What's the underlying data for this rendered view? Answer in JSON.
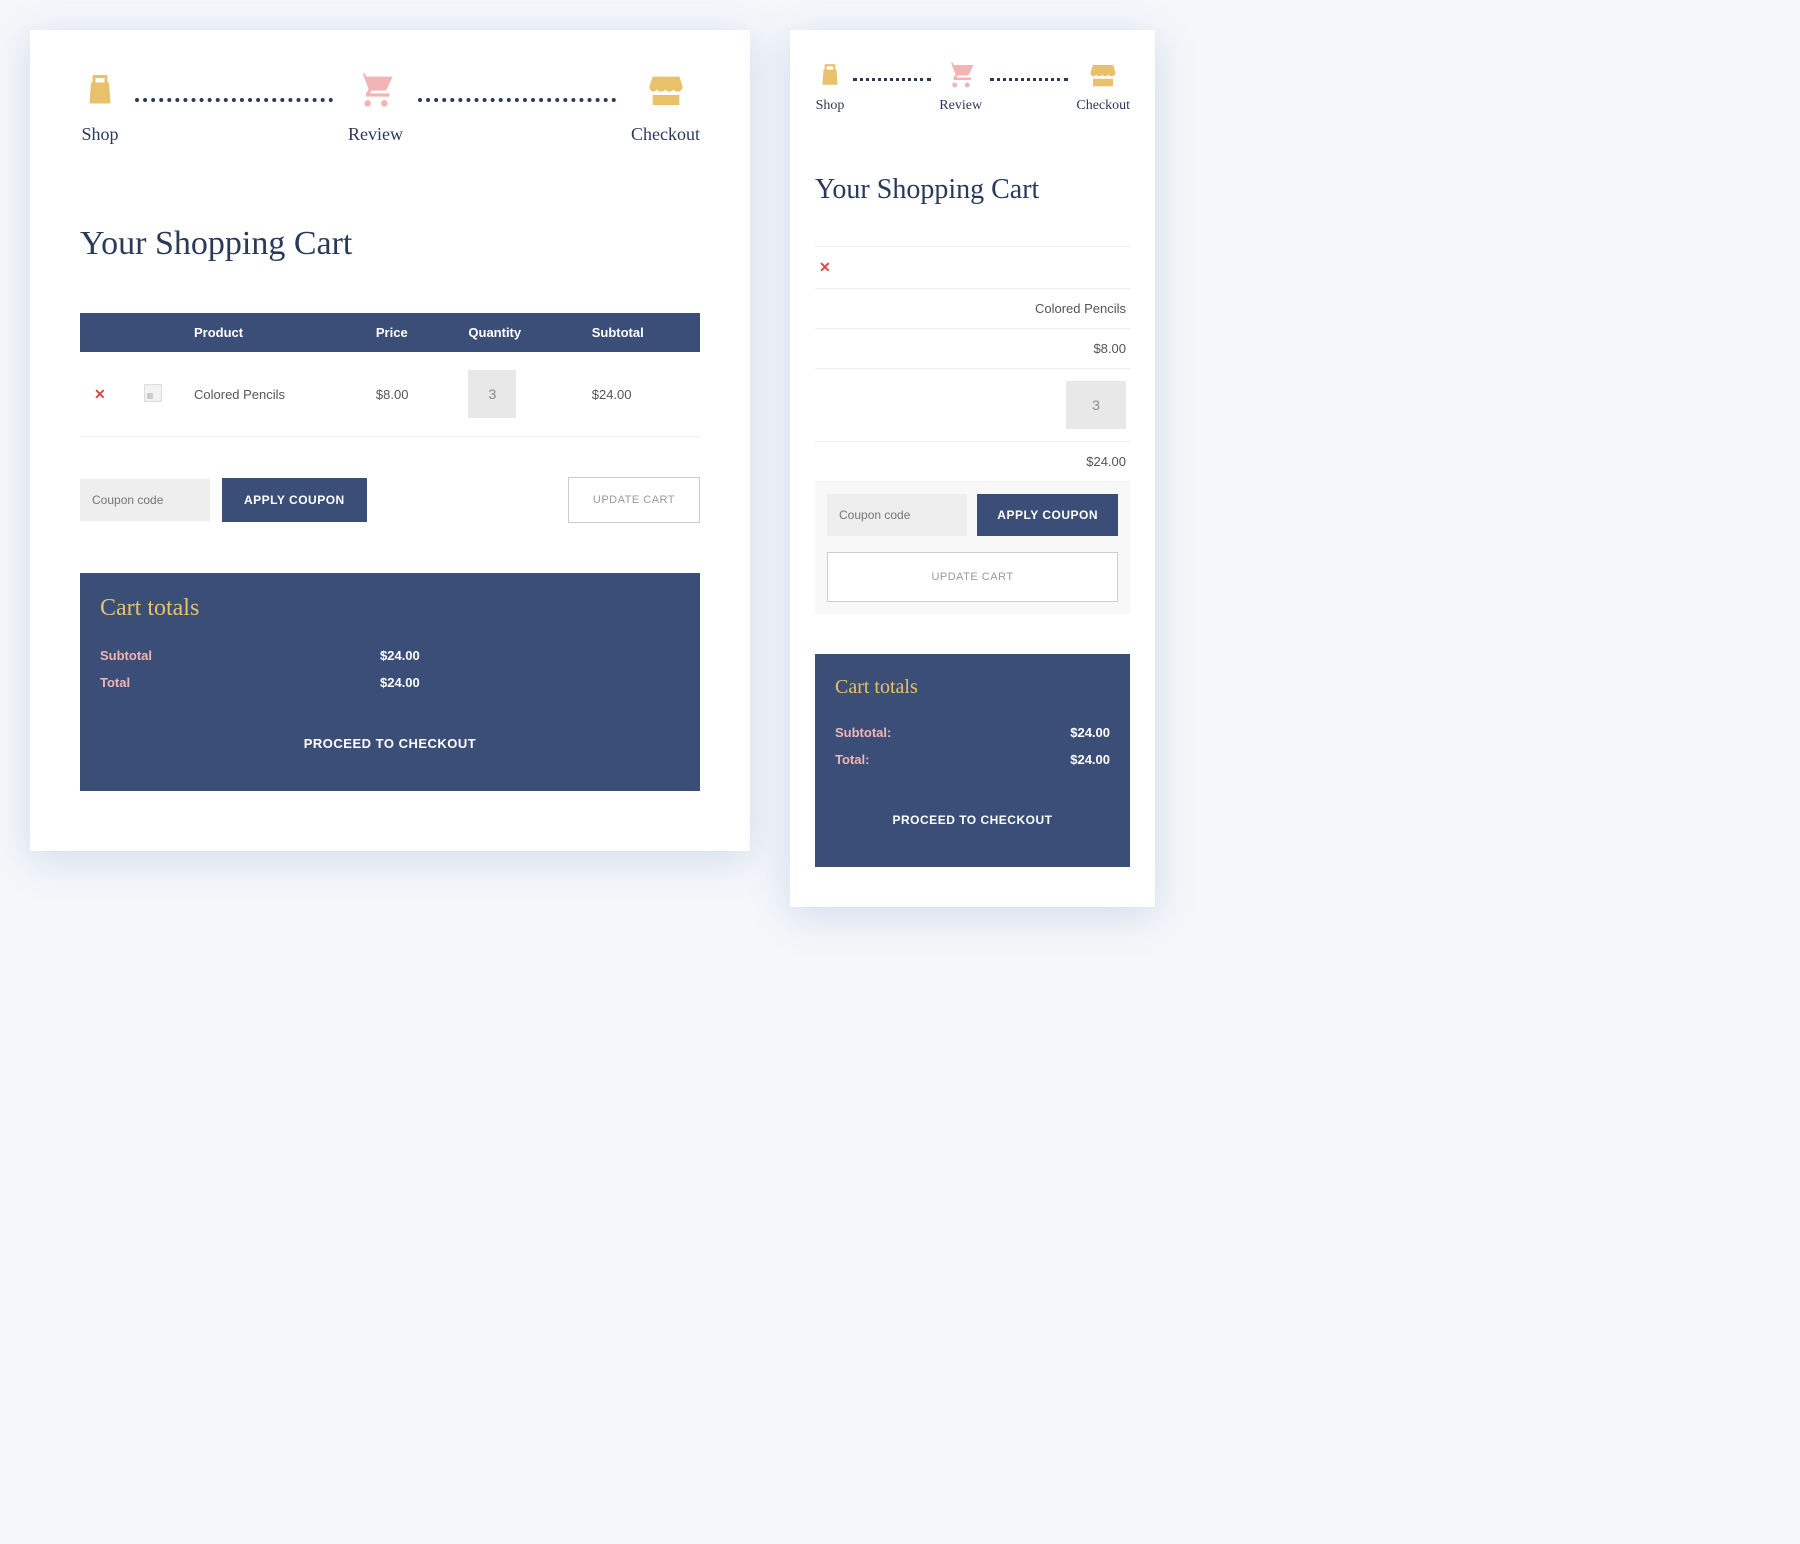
{
  "steps": {
    "shop": "Shop",
    "review": "Review",
    "checkout": "Checkout"
  },
  "title": "Your Shopping Cart",
  "table": {
    "headers": {
      "product": "Product",
      "price": "Price",
      "quantity": "Quantity",
      "subtotal": "Subtotal"
    },
    "item": {
      "name": "Colored Pencils",
      "price": "$8.00",
      "qty": "3",
      "subtotal": "$24.00"
    }
  },
  "mobile_item": {
    "name": "Colored Pencils",
    "price": "$8.00",
    "qty": "3",
    "subtotal": "$24.00"
  },
  "coupon": {
    "placeholder": "Coupon code",
    "apply": "APPLY COUPON",
    "update": "UPDATE CART"
  },
  "totals": {
    "title": "Cart totals",
    "subtotal_label": "Subtotal",
    "subtotal_label_m": "Subtotal:",
    "subtotal": "$24.00",
    "total_label": "Total",
    "total_label_m": "Total:",
    "total": "$24.00",
    "checkout": "PROCEED TO CHECKOUT"
  }
}
